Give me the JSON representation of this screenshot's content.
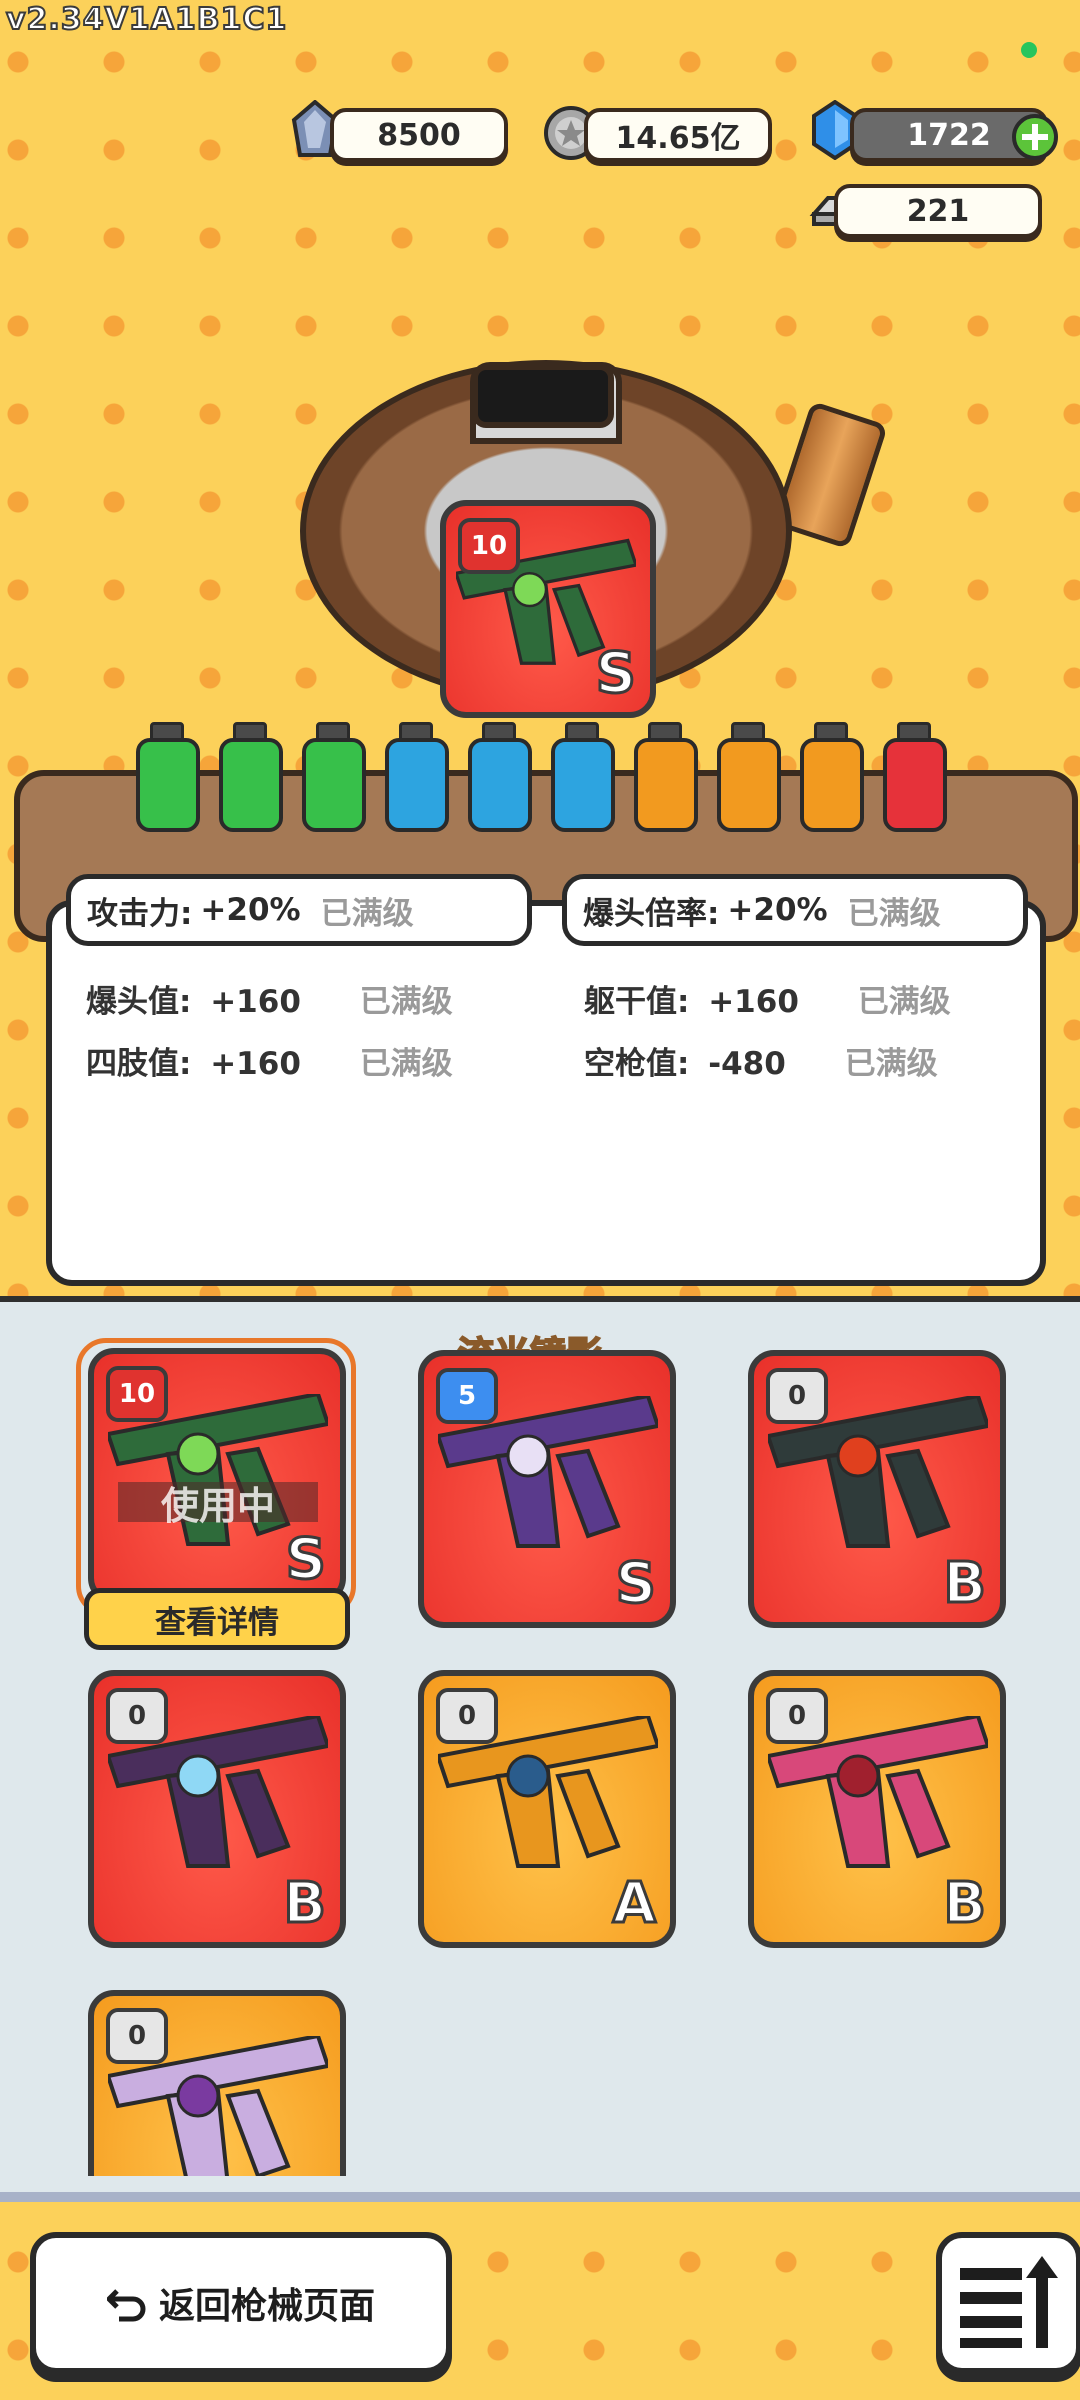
{
  "version": "v2.34V1A1B1C1",
  "currencies": {
    "crystal": "8500",
    "coins": "14.65亿",
    "gems": "1722",
    "silver": "221"
  },
  "machine": {
    "card_level": "10",
    "card_grade": "S",
    "bottles": [
      "green",
      "green",
      "green",
      "blue",
      "blue",
      "blue",
      "orange",
      "orange",
      "orange",
      "red"
    ]
  },
  "stats": {
    "attack_label": "攻击力:",
    "attack_value": "+20%",
    "headshot_rate_label": "爆头倍率:",
    "headshot_rate_value": "+20%",
    "headshot_label": "爆头值:",
    "headshot_value": "+160",
    "torso_label": "躯干值:",
    "torso_value": "+160",
    "limb_label": "四肢值:",
    "limb_value": "+160",
    "empty_label": "空枪值:",
    "empty_value": "-480",
    "maxed": "已满级"
  },
  "inventory": {
    "special_tag": "流光镜影",
    "in_use": "使用中",
    "details_button": "查看详情",
    "skins": [
      {
        "level": "10",
        "grade": "S"
      },
      {
        "level": "5",
        "grade": "S"
      },
      {
        "level": "0",
        "grade": "B"
      },
      {
        "level": "0",
        "grade": "B"
      },
      {
        "level": "0",
        "grade": "A"
      },
      {
        "level": "0",
        "grade": "B"
      },
      {
        "level": "0",
        "grade": ""
      }
    ]
  },
  "bottom": {
    "back_button": "返回枪械页面"
  },
  "colors": {
    "background": "#fcd15a",
    "dots": "#f6a53a",
    "card_red": "#e8302a",
    "card_orange": "#f59b1e",
    "selected_border": "#e8772a"
  }
}
